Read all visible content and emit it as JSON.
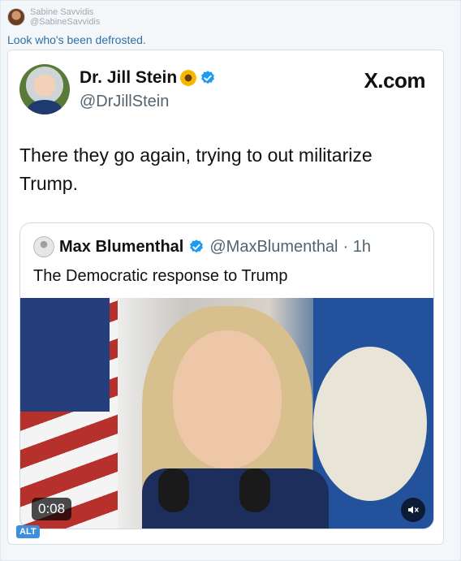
{
  "post": {
    "author_display": "Sabine Savvidis",
    "author_handle": "@SabineSavvidis",
    "text": "Look who's been defrosted."
  },
  "tweet": {
    "name": "Dr. Jill Stein",
    "handle": "@DrJillStein",
    "site": "X.com",
    "text": "There they go again, trying to out militarize Trump."
  },
  "quote": {
    "name": "Max Blumenthal",
    "handle": "@MaxBlumenthal",
    "meta": "· 1h",
    "text": "The Democratic response to Trump"
  },
  "video": {
    "time": "0:08",
    "mute_icon": "speaker-muted-icon"
  },
  "alt_label": "ALT",
  "colors": {
    "link_blue": "#2c6fa8",
    "verified_blue": "#1d9bf0",
    "alt_badge": "#3d8fd9"
  }
}
